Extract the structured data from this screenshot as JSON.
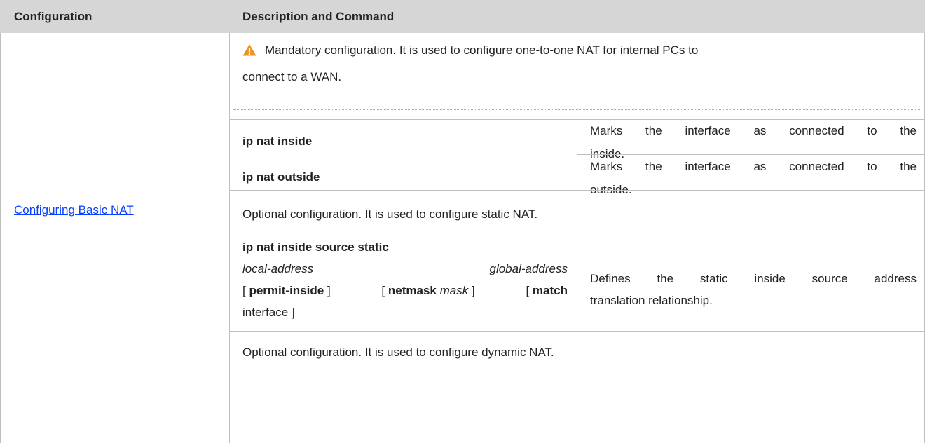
{
  "table": {
    "headers": {
      "configuration": "Configuration",
      "description": "Description and Command"
    },
    "config_link": "Configuring Basic NAT",
    "mandatory": {
      "icon": "warning-icon",
      "text_line1": "Mandatory configuration. It is used to configure one-to-one NAT for internal PCs to",
      "text_line2": "connect to a WAN."
    },
    "commands_basic": [
      {
        "command": "ip nat inside",
        "desc_line1": "Marks the interface as connected to the",
        "desc_line2": "inside."
      },
      {
        "command": "ip nat outside",
        "desc_line1": "Marks the interface as connected to the",
        "desc_line2": "outside."
      }
    ],
    "optional_static": "Optional configuration. It is used to configure static NAT.",
    "static_command": {
      "line1": "ip nat inside source static",
      "arg_local": "local-address",
      "arg_global": "global-address",
      "bracket_open": "[",
      "permit_inside": "permit-inside",
      "bracket_close": "]",
      "netmask_kw": "netmask",
      "mask_arg": "mask",
      "match_kw": "match",
      "interface_word": "interface",
      "desc_line1": "Defines the static inside source address",
      "desc_line2": "translation relationship."
    },
    "optional_dynamic": "Optional configuration. It is used to configure dynamic NAT."
  },
  "colors": {
    "header_bg": "#d6d6d6",
    "link": "#0a40ff",
    "warning": "#f0921e",
    "border": "#bfbfbf"
  }
}
